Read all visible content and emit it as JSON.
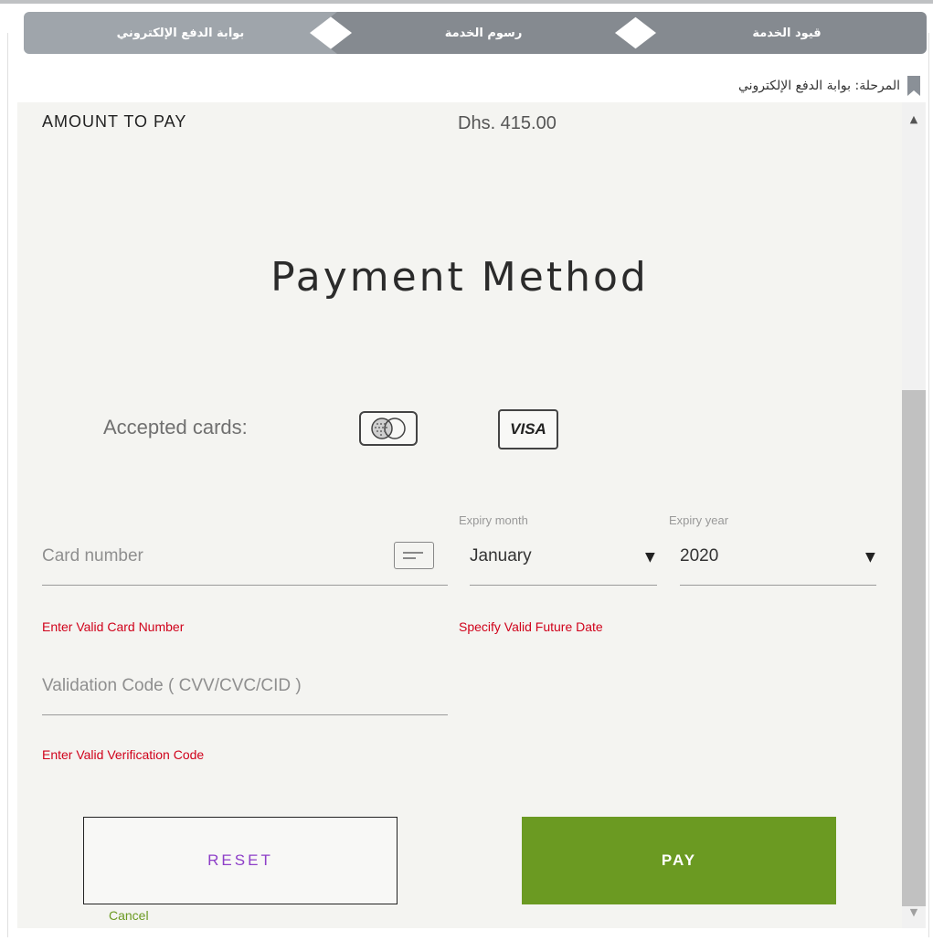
{
  "steps": [
    {
      "label": "قيود الخدمة"
    },
    {
      "label": "رسوم الخدمة"
    },
    {
      "label": "بوابة الدفع الإلكتروني"
    }
  ],
  "stage": {
    "text": "المرحلة: بوابة الدفع الإلكتروني",
    "icon": "bookmark-icon"
  },
  "payment": {
    "amount_label": "AMOUNT TO PAY",
    "amount_value": "Dhs. 415.00",
    "title": "Payment Method",
    "accepted_label": "Accepted cards:",
    "cards": [
      {
        "icon": "mastercard-icon"
      },
      {
        "icon": "visa-icon",
        "text": "VISA"
      }
    ],
    "card_number": {
      "placeholder": "Card number",
      "icon": "credit-card-icon",
      "error": "Enter Valid Card Number"
    },
    "expiry_month": {
      "label": "Expiry month",
      "value": "January"
    },
    "expiry_year": {
      "label": "Expiry year",
      "value": "2020"
    },
    "expiry_error": "Specify Valid Future Date",
    "cvv": {
      "placeholder": "Validation Code ( CVV/CVC/CID )",
      "error": "Enter Valid Verification Code"
    },
    "reset_label": "RESET",
    "pay_label": "PAY",
    "cancel_label": "Cancel"
  },
  "colors": {
    "step_active": "#9fa5ab",
    "step_inactive": "#858a90",
    "panel_bg": "#f4f4f1",
    "error": "#d0021b",
    "pay_button": "#6b9a22",
    "reset_text": "#8e3fc8"
  }
}
